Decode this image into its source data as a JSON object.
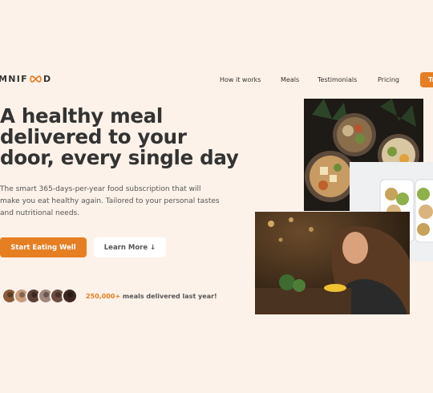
{
  "brand": {
    "name_left": "MNIF",
    "name_right": "D",
    "accent": "#e67e22",
    "background": "#fdf2e9"
  },
  "nav": {
    "items": [
      "How it works",
      "Meals",
      "Testimonials",
      "Pricing"
    ],
    "cta_label": "Tr"
  },
  "hero": {
    "title": "A healthy meal delivered to your door, every single day",
    "description": "The smart 365-days-per-year food subscription that will make you eat healthy again. Tailored to your personal tastes and nutritional needs.",
    "primary_button": "Start Eating Well",
    "secondary_button": "Learn More ↓",
    "delivered_count": "250,000+",
    "delivered_text": " meals delivered last year!",
    "avatar_colors": [
      "#8b5a3c",
      "#c89b7b",
      "#5d4037",
      "#a1887f",
      "#6d4c41",
      "#3e2723"
    ]
  },
  "images": [
    "meal-bowls-photo",
    "meal-prep-containers-photo",
    "woman-eating-photo"
  ]
}
